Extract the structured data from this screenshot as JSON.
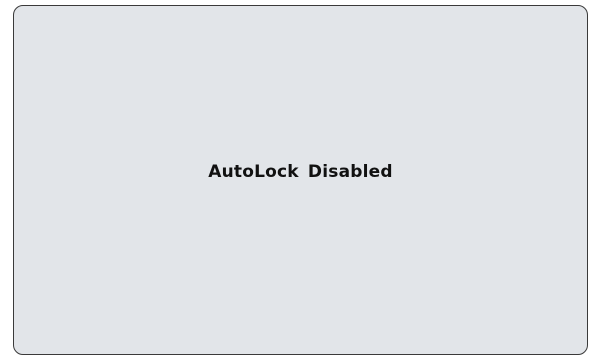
{
  "dialog": {
    "message": "AutoLock Disabled"
  },
  "colors": {
    "panel_background": "#e2e5e9",
    "panel_border": "#3a3a3a",
    "text": "#111111"
  }
}
